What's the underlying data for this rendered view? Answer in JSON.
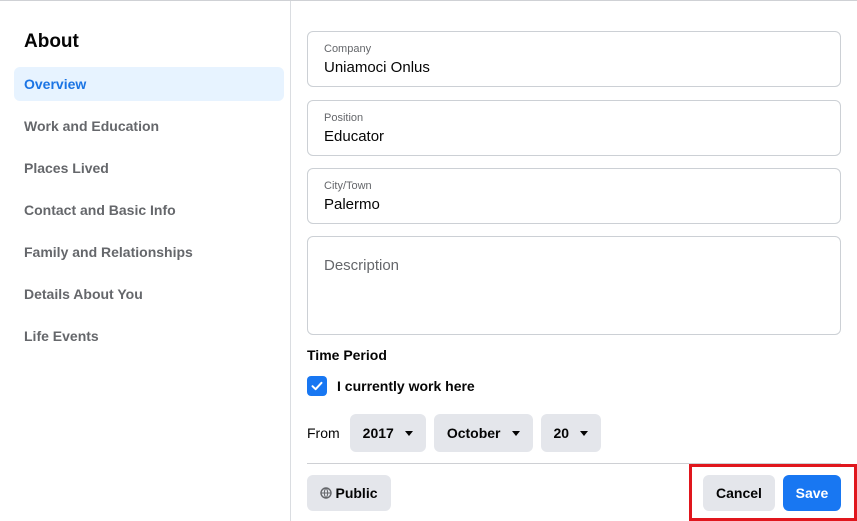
{
  "sidebar": {
    "title": "About",
    "items": [
      {
        "label": "Overview",
        "active": true
      },
      {
        "label": "Work and Education"
      },
      {
        "label": "Places Lived"
      },
      {
        "label": "Contact and Basic Info"
      },
      {
        "label": "Family and Relationships"
      },
      {
        "label": "Details About You"
      },
      {
        "label": "Life Events"
      }
    ]
  },
  "form": {
    "company": {
      "label": "Company",
      "value": "Uniamoci Onlus"
    },
    "position": {
      "label": "Position",
      "value": "Educator"
    },
    "city": {
      "label": "City/Town",
      "value": "Palermo"
    },
    "description": {
      "placeholder": "Description"
    },
    "time_period": {
      "title": "Time Period",
      "current_label": "I currently work here",
      "current_checked": true,
      "from_label": "From",
      "year": "2017",
      "month": "October",
      "day": "20"
    }
  },
  "footer": {
    "privacy_label": "Public",
    "cancel_label": "Cancel",
    "save_label": "Save"
  },
  "colors": {
    "accent": "#1877f2",
    "active_nav_bg": "#e7f3ff",
    "highlight_box": "#e0161d"
  },
  "icons": {
    "privacy": "globe-icon",
    "checkbox": "checkmark-icon",
    "dropdown": "caret-down-icon"
  }
}
